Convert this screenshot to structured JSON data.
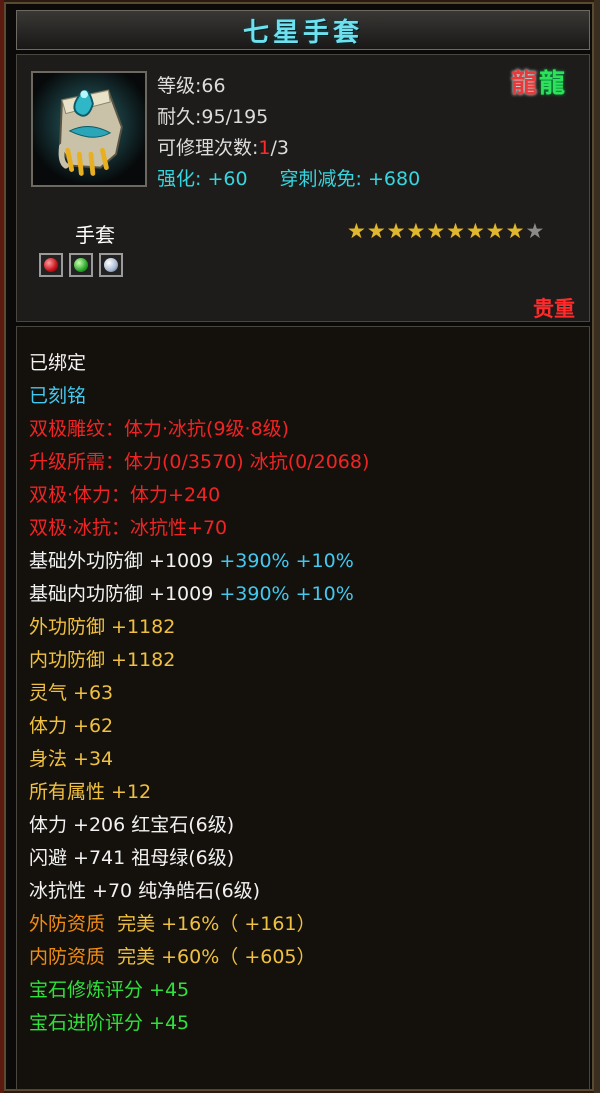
{
  "item": {
    "name": "七星手套",
    "level": "等级:66",
    "durability": "耐久:95/195",
    "repair_label": "可修理次数:",
    "repair_used": "1",
    "repair_total": "/3",
    "enhance": "强化: +60",
    "pierce": "穿刺减免: +680",
    "type": "手套",
    "rarity": "贵重",
    "stars_filled": 9,
    "stars_total": 10,
    "gems": [
      "red-gem",
      "green-gem",
      "white-gem"
    ],
    "colors": {
      "title": "#6fe0ee",
      "white": "#f2f2f2",
      "cyan": "#43c8f0",
      "red": "#f02424",
      "yellow": "#f0c040",
      "orange": "#f08c14",
      "green": "#31e03c"
    }
  },
  "attributes": [
    [
      {
        "t": "已绑定",
        "c": "w"
      }
    ],
    [
      {
        "t": "已刻铭",
        "c": "c"
      }
    ],
    [
      {
        "t": "双极雕纹：体力·冰抗(9级·8级)",
        "c": "r"
      }
    ],
    [
      {
        "t": "升级所需：体力(0/3570) 冰抗(0/2068)",
        "c": "r"
      }
    ],
    [
      {
        "t": "双极·体力：体力+240",
        "c": "r"
      }
    ],
    [
      {
        "t": "双极·冰抗：冰抗性+70",
        "c": "r"
      }
    ],
    [
      {
        "t": "基础外功防御 +1009 ",
        "c": "w"
      },
      {
        "t": "+390% +10%",
        "c": "c"
      }
    ],
    [
      {
        "t": "基础内功防御 +1009 ",
        "c": "w"
      },
      {
        "t": "+390% +10%",
        "c": "c"
      }
    ],
    [
      {
        "t": "外功防御 +1182",
        "c": "y"
      }
    ],
    [
      {
        "t": "内功防御 +1182",
        "c": "y"
      }
    ],
    [
      {
        "t": "灵气 +63",
        "c": "y"
      }
    ],
    [
      {
        "t": "体力 +62",
        "c": "y"
      }
    ],
    [
      {
        "t": "身法 +34",
        "c": "y"
      }
    ],
    [
      {
        "t": "所有属性 +12",
        "c": "y"
      }
    ],
    [
      {
        "t": "体力 +206 红宝石(6级)",
        "c": "w"
      }
    ],
    [
      {
        "t": "闪避 +741 祖母绿(6级)",
        "c": "w"
      }
    ],
    [
      {
        "t": "冰抗性 +70 纯净皓石(6级)",
        "c": "w"
      }
    ],
    [
      {
        "t": "外防资质 ",
        "c": "o"
      },
      {
        "t": " 完美 +16%（ +161）",
        "c": "y"
      }
    ],
    [
      {
        "t": "内防资质 ",
        "c": "o"
      },
      {
        "t": " 完美 +60%（ +605）",
        "c": "y"
      }
    ],
    [
      {
        "t": "宝石修炼评分 +45",
        "c": "g"
      }
    ],
    [
      {
        "t": "宝石进阶评分 +45",
        "c": "g"
      }
    ]
  ]
}
